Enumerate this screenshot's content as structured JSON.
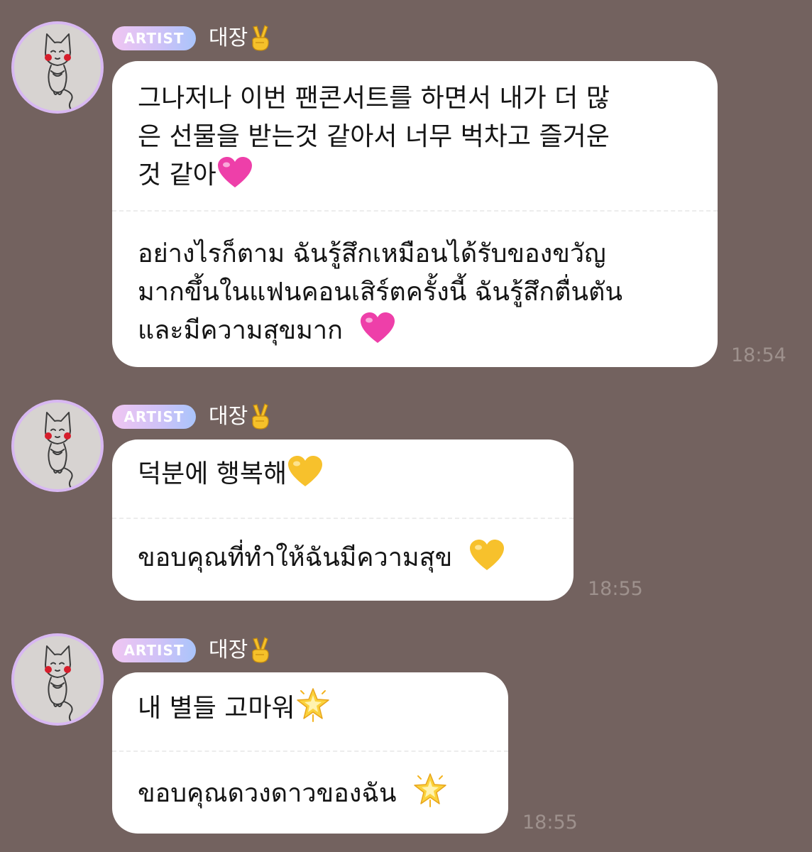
{
  "badge_label": "ARTIST",
  "sender_name": "대장",
  "messages": [
    {
      "korean_text": "그나저나 이번 팬콘서트를 하면서 내가 더 많\n은 선물을 받는것 같아서 너무 벅차고 즐거운\n것 같아",
      "korean_emoji": "pink-heart-icon",
      "thai_text": "อย่างไรก็ตาม ฉันรู้สึกเหมือนได้รับของขวัญ\nมากขึ้นในแฟนคอนเสิร์ตครั้งนี้ ฉันรู้สึกตื่นตัน\nและมีความสุขมาก",
      "thai_emoji": "pink-heart-icon",
      "time": "18:54"
    },
    {
      "korean_text": "덕분에 행복해",
      "korean_emoji": "yellow-heart-icon",
      "thai_text": "ขอบคุณที่ทำให้ฉันมีความสุข",
      "thai_emoji": "yellow-heart-icon",
      "time": "18:55"
    },
    {
      "korean_text": "내 별들 고마워",
      "korean_emoji": "glowing-star-icon",
      "thai_text": "ขอบคุณดวงดาวของฉัน",
      "thai_emoji": "glowing-star-icon",
      "time": "18:55"
    }
  ],
  "colors": {
    "background": "#73625f",
    "bubble": "#ffffff",
    "avatar_ring": "#d8b8f2",
    "timestamp": "#9e918d"
  }
}
